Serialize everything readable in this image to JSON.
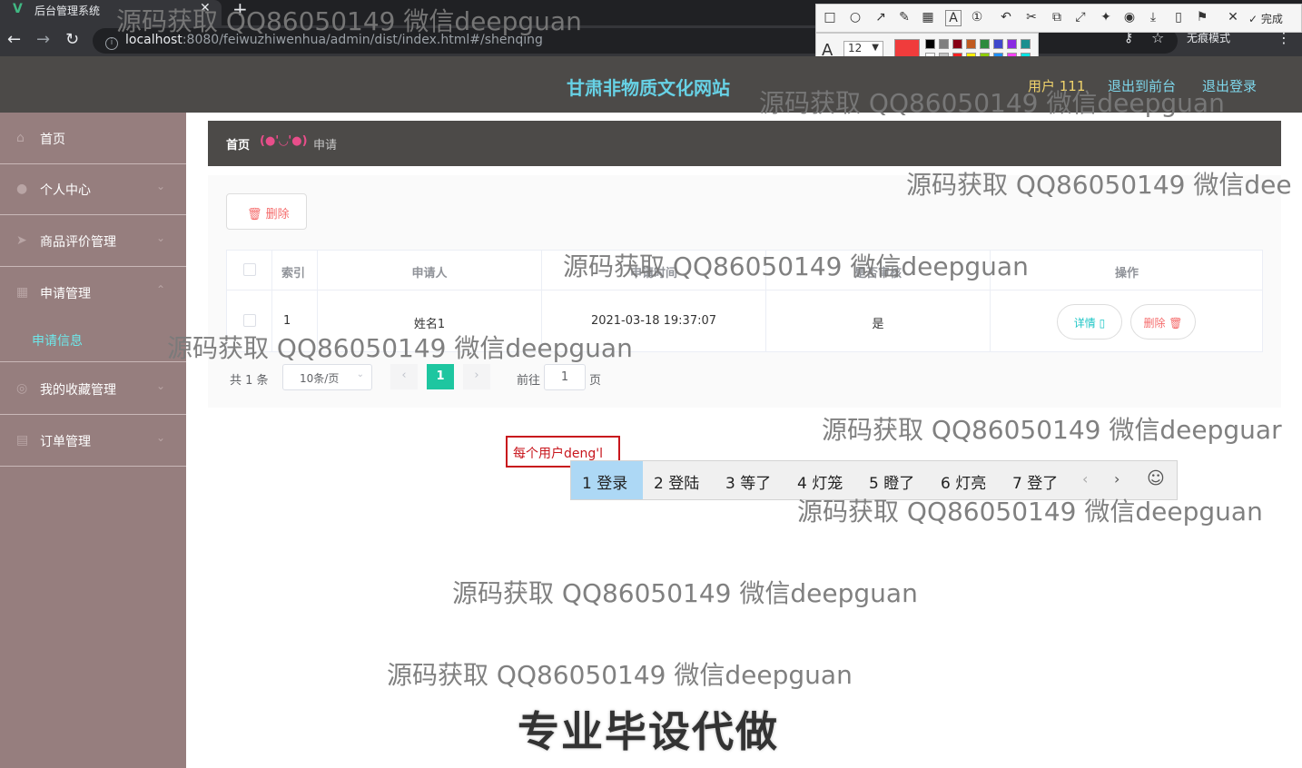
{
  "browser": {
    "tab_title": "后台管理系统",
    "url_host": "localhost",
    "url_rest": ":8080/feiwuzhiwenhua/admin/dist/index.html#/shenqing",
    "incognito": "无痕模式",
    "new_tab": "+",
    "tab_close": "✕"
  },
  "screenshot_tool": {
    "done_label": "完成",
    "font_size": "12",
    "current_color": "#f03c3c",
    "palette": [
      "#000000",
      "#7f7f7f",
      "#880015",
      "#c05a1f",
      "#2e8b3d",
      "#3f48cc",
      "#8a2be2",
      "#1b8f8f",
      "#ffffff",
      "#c3c3c3",
      "#ff2020",
      "#ffee00",
      "#8fce00",
      "#1e90ff",
      "#ff40ff",
      "#00e5e5"
    ]
  },
  "header": {
    "site_title": "甘肃非物质文化网站",
    "user": "用户 111",
    "back_front": "退出到前台",
    "logout": "退出登录"
  },
  "sidebar": {
    "items": [
      {
        "label": "首页",
        "icon": "home-icon"
      },
      {
        "label": "个人中心",
        "icon": "user-icon"
      },
      {
        "label": "商品评价管理",
        "icon": "send-icon"
      },
      {
        "label": "申请管理",
        "icon": "calendar-icon"
      },
      {
        "label": "我的收藏管理",
        "icon": "compass-icon"
      },
      {
        "label": "订单管理",
        "icon": "doc-icon"
      }
    ],
    "sub_item": "申请信息"
  },
  "breadcrumb": {
    "home": "首页",
    "separator": "(●'◡'●)",
    "current": "申请"
  },
  "toolbar": {
    "delete_label": "删除"
  },
  "table": {
    "headers": [
      "索引",
      "申请人",
      "申请时间",
      "是否审核",
      "操作"
    ],
    "rows": [
      {
        "index": "1",
        "applicant": "姓名1",
        "time": "2021-03-18 19:37:07",
        "reviewed": "是",
        "detail": "详情",
        "delete": "删除"
      }
    ]
  },
  "pagination": {
    "total": "共 1 条",
    "page_size": "10条/页",
    "current": "1",
    "goto_label": "前往",
    "goto_value": "1",
    "page_suffix": "页",
    "prev": "‹",
    "next": "›"
  },
  "ime": {
    "composition": "每个用户deng'l",
    "candidates": [
      "1 登录",
      "2 登陆",
      "3 等了",
      "4 灯笼",
      "5 瞪了",
      "6 灯亮",
      "7 登了"
    ],
    "prev": "‹",
    "next": "›",
    "emoji": "☺"
  },
  "watermarks": {
    "text": "源码获取 QQ86050149 微信deepguan",
    "text_clipped": "源码获取 QQ86050149 微信dee",
    "text_clipped2": "源码获取 QQ86050149 微信deepguar",
    "banner": "专业毕设代做"
  }
}
